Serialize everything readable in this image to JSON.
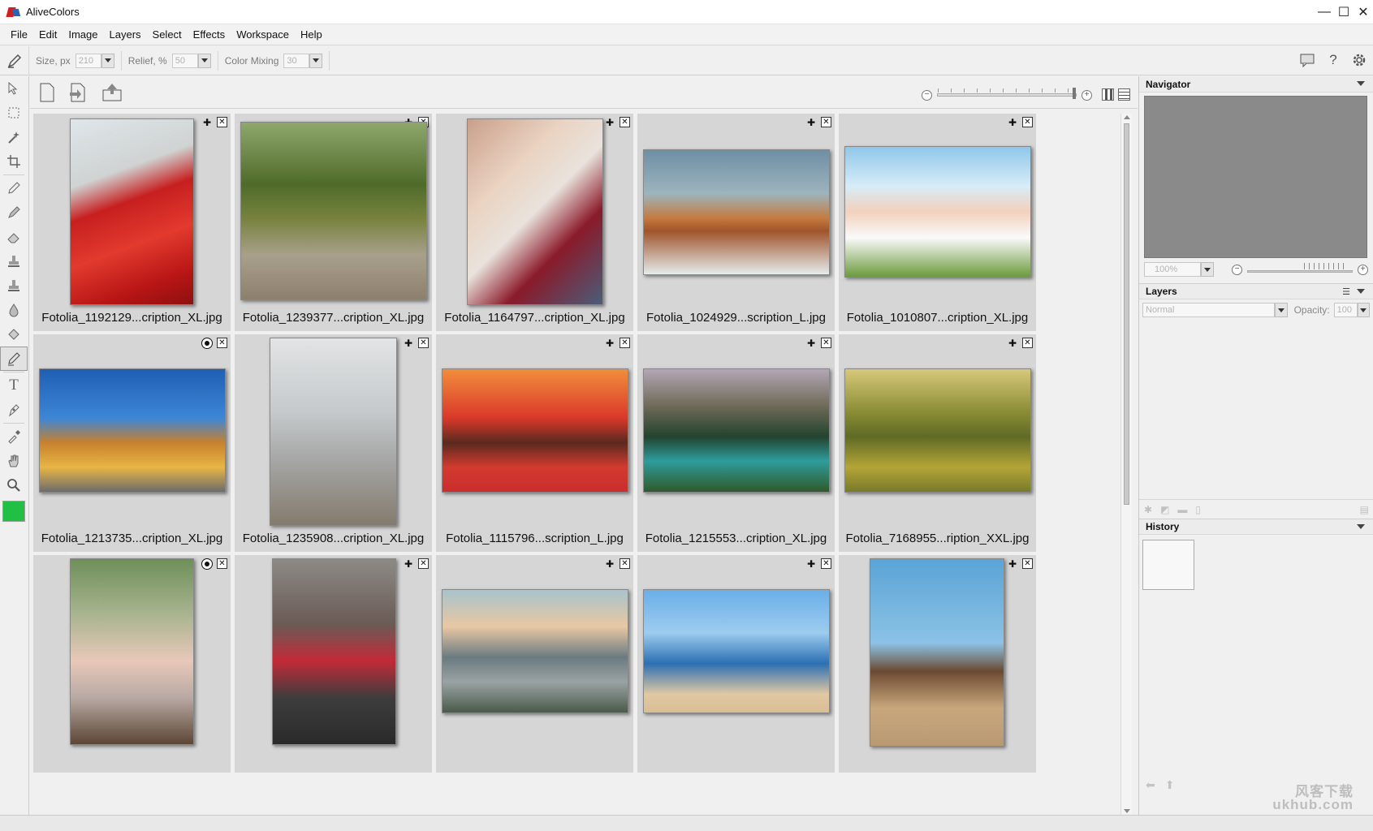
{
  "window": {
    "title": "AliveColors",
    "minimize": "—",
    "maximize": "☐",
    "close": "✕"
  },
  "menu": [
    "File",
    "Edit",
    "Image",
    "Layers",
    "Select",
    "Effects",
    "Workspace",
    "Help"
  ],
  "options": {
    "size_label": "Size, px",
    "size_value": "210",
    "relief_label": "Relief, %",
    "relief_value": "50",
    "mixing_label": "Color Mixing",
    "mixing_value": "30"
  },
  "foreground_color": "#21c045",
  "images": [
    {
      "name": "Fotolia_1192129...cription_XL.jpg",
      "badge": "pin",
      "bg": "linear-gradient(160deg,#dfe6ea 0%,#cfd3d2 30%,#c71f1f 45%,#e23a2e 65%,#b81515 85%,#8f1010 100%)"
    },
    {
      "name": "Fotolia_1239377...cription_XL.jpg",
      "badge": "pin",
      "bg": "linear-gradient(180deg,#8ea86c 0%,#4f6b2a 35%,#79833f 55%,#a8a08c 75%,#8d7f6d 100%)"
    },
    {
      "name": "Fotolia_1164797...cription_XL.jpg",
      "badge": "pin",
      "bg": "linear-gradient(135deg,#c9a08a 0%,#ead3c2 30%,#e9e3dc 50%,#8a1a2a 70%,#4a5d7a 100%)"
    },
    {
      "name": "Fotolia_1024929...scription_L.jpg",
      "badge": "pin",
      "bg": "linear-gradient(180deg,#6f8fa4 0%,#9db4bd 35%,#c57a3f 55%,#a0532a 65%,#e4ecec 100%)"
    },
    {
      "name": "Fotolia_1010807...cription_XL.jpg",
      "badge": "pin",
      "bg": "linear-gradient(180deg,#8fc7ea 0%,#d6ecf7 30%,#f2d1bd 50%,#fafafa 70%,#6d9a3d 100%)"
    },
    {
      "name": "Fotolia_1213735...cription_XL.jpg",
      "badge": "radio",
      "bg": "linear-gradient(180deg,#1f5fb3 0%,#3d86d6 40%,#c8812e 60%,#e7b545 80%,#6c6c6c 100%)"
    },
    {
      "name": "Fotolia_1235908...cription_XL.jpg",
      "badge": "pin",
      "bg": "linear-gradient(180deg,#e2e4e5 0%,#c5c9cb 40%,#a6a7a6 65%,#847b6e 100%)"
    },
    {
      "name": "Fotolia_1115796...scription_L.jpg",
      "badge": "pin",
      "bg": "linear-gradient(180deg,#f28d3c 0%,#d9382a 40%,#5a2a1f 60%,#d33a2f 80%,#c92d2d 100%)"
    },
    {
      "name": "Fotolia_1215553...cription_XL.jpg",
      "badge": "pin",
      "bg": "linear-gradient(180deg,#b3a7b5 0%,#6f6a58 30%,#23432e 55%,#2e9d9b 75%,#2f5a2a 100%)"
    },
    {
      "name": "Fotolia_7168955...ription_XXL.jpg",
      "badge": "pin",
      "bg": "linear-gradient(180deg,#d7c87a 0%,#8a8d35 35%,#5f6a25 55%,#b3a537 80%,#787a2a 100%)"
    },
    {
      "name": "",
      "badge": "radio",
      "bg": "linear-gradient(180deg,#6e8f5a 0%,#a9b48f 30%,#e8c8b9 55%,#b8a9a4 75%,#5c4635 100%)"
    },
    {
      "name": "",
      "badge": "pin",
      "bg": "linear-gradient(180deg,#8d8a86 0%,#6a5b55 35%,#c22a38 55%,#3d3d3d 75%,#2a2a2a 100%)"
    },
    {
      "name": "",
      "badge": "pin",
      "bg": "linear-gradient(180deg,#a8c3cc 0%,#e8c8a3 30%,#6a7a80 55%,#9aa3a4 75%,#4a5a4a 100%)"
    },
    {
      "name": "",
      "badge": "pin",
      "bg": "linear-gradient(180deg,#6aaee8 0%,#9dccef 35%,#2c6fb3 60%,#e0c9a3 85%,#d9bd95 100%)"
    },
    {
      "name": "",
      "badge": "pin",
      "bg": "linear-gradient(180deg,#5aa4d6 0%,#8cc2e6 45%,#6b4a32 60%,#c9a77d 80%,#b89a72 100%)"
    }
  ],
  "panels": {
    "navigator": {
      "title": "Navigator",
      "zoom": "100%"
    },
    "layers": {
      "title": "Layers",
      "blend_mode": "Normal",
      "opacity_label": "Opacity:",
      "opacity_value": "100"
    },
    "history": {
      "title": "History"
    }
  },
  "watermark": {
    "line1": "风客下载",
    "line2": "ukhub.com"
  }
}
